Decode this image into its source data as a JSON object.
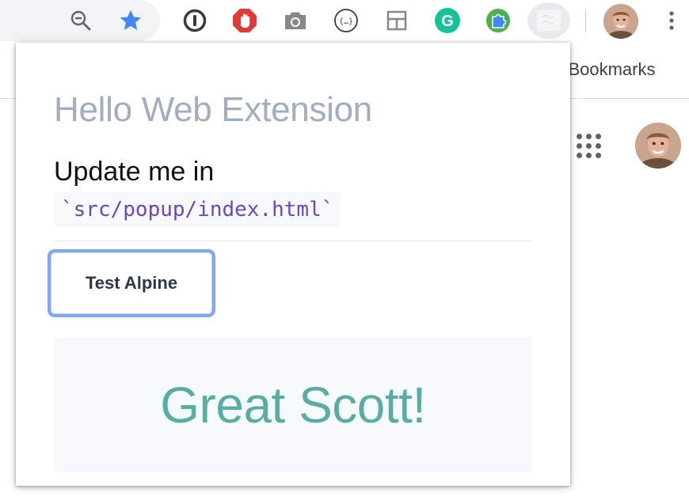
{
  "browser": {
    "toolbar_icons": [
      "zoom-out-icon",
      "bookmark-star-icon",
      "1password-icon",
      "adblock-icon",
      "screenshot-camera-icon",
      "json-formatter-icon",
      "layout-icon",
      "grammarly-icon",
      "puzzle-extension-icon",
      "tailwind-extension-icon",
      "profile-avatar",
      "more-menu-icon"
    ],
    "bookmarks_label": "r Bookmarks",
    "colors": {
      "star": "#4285f4",
      "adblock": "#e53935",
      "grammarly": "#15c39a",
      "tailwind": "#38b2ac"
    }
  },
  "popup": {
    "title": "Hello Web Extension",
    "text": "Update me in",
    "code": "`src/popup/index.html`",
    "button_label": "Test Alpine",
    "result_text": "Great Scott!",
    "colors": {
      "title": "#a0aec0",
      "code": "#6b46c1",
      "result": "#5aada3",
      "focus_ring": "#7ea7f5"
    }
  }
}
